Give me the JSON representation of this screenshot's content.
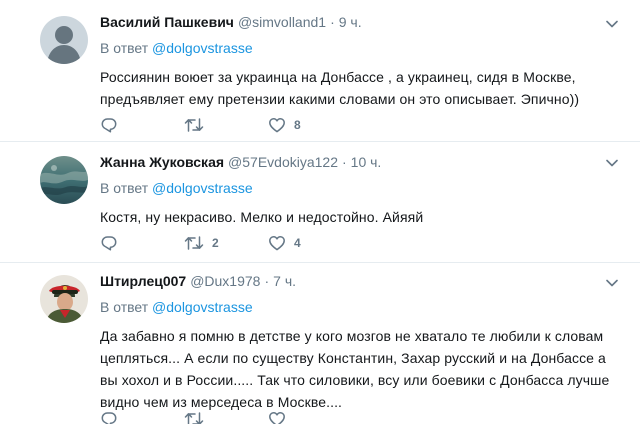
{
  "tweets": [
    {
      "name": "Василий Пашкевич",
      "handle": "@simvolland1",
      "dot": "·",
      "time": "9 ч.",
      "reply_prefix": "В ответ",
      "reply_mention": "@dolgovstrasse",
      "text": "Россиянин воюет за украинца на Донбассе , а украинец, сидя в Москве, предъявляет ему претензии какими словами он это описывает. Эпично))",
      "reply_count": "",
      "retweet_count": "",
      "like_count": "8",
      "avatar": "default-avatar"
    },
    {
      "name": "Жанна Жуковская",
      "handle": "@57Evdokiya122",
      "dot": "·",
      "time": "10 ч.",
      "reply_prefix": "В ответ",
      "reply_mention": "@dolgovstrasse",
      "text": "Костя, ну некрасиво. Мелко и недостойно. Айяяй",
      "reply_count": "",
      "retweet_count": "2",
      "like_count": "4",
      "avatar": "sea-photo-avatar"
    },
    {
      "name": "Штирлец007",
      "handle": "@Dux1978",
      "dot": "·",
      "time": "7 ч.",
      "reply_prefix": "В ответ",
      "reply_mention": "@dolgovstrasse",
      "text": "Да забавно я помню в детстве у кого мозгов не хватало те любили к словам цепляться... А если по существу Константин, Захар русский и на Донбассе а вы хохол и в России..... Так что силовики, всу или боевики с Донбасса лучше видно чем из мерседеса в Москве....",
      "reply_count": "",
      "retweet_count": "",
      "like_count": "",
      "avatar": "officer-cap-avatar"
    }
  ],
  "colors": {
    "text": "#14171a",
    "muted": "#657786",
    "link": "#1b95e0",
    "divider": "#e6ecf0"
  },
  "icons": [
    "reply-icon",
    "retweet-icon",
    "like-icon",
    "chevron-down-icon"
  ]
}
